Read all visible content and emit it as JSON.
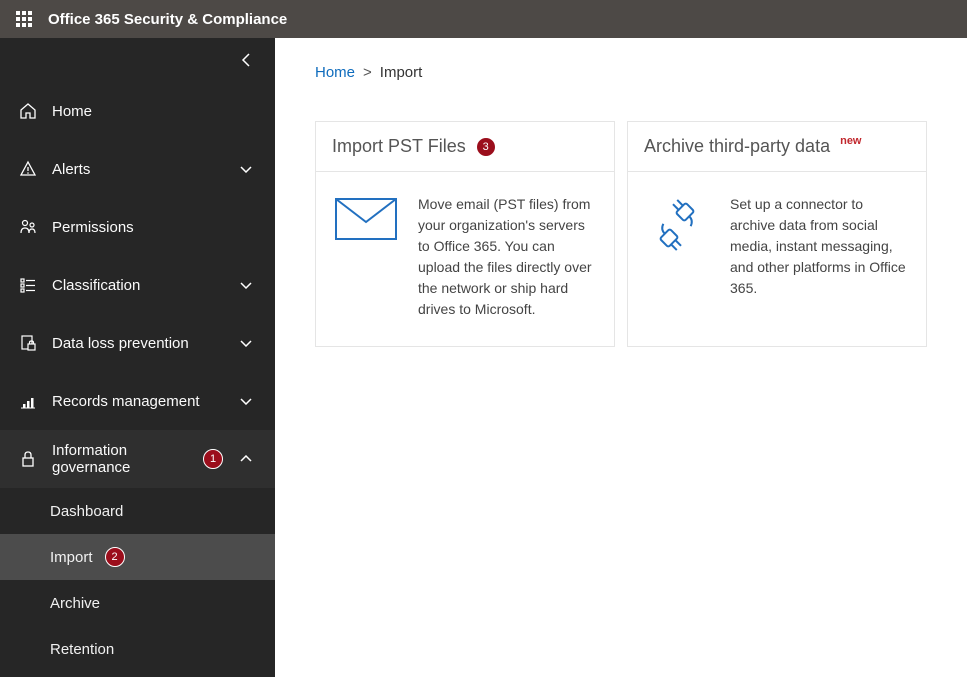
{
  "header": {
    "app_title": "Office 365 Security & Compliance"
  },
  "sidebar": {
    "items": [
      {
        "id": "home",
        "label": "Home",
        "icon": "home-icon",
        "expandable": false
      },
      {
        "id": "alerts",
        "label": "Alerts",
        "icon": "alert-icon",
        "expandable": true
      },
      {
        "id": "permissions",
        "label": "Permissions",
        "icon": "permissions-icon",
        "expandable": false
      },
      {
        "id": "classification",
        "label": "Classification",
        "icon": "classification-icon",
        "expandable": true
      },
      {
        "id": "dlp",
        "label": "Data loss prevention",
        "icon": "dlp-icon",
        "expandable": true
      },
      {
        "id": "records",
        "label": "Records management",
        "icon": "records-icon",
        "expandable": true
      },
      {
        "id": "info-gov",
        "label": "Information governance",
        "icon": "lock-icon",
        "expandable": true,
        "expanded": true,
        "badge": "1",
        "children": [
          {
            "id": "dashboard",
            "label": "Dashboard"
          },
          {
            "id": "import",
            "label": "Import",
            "selected": true,
            "badge": "2"
          },
          {
            "id": "archive",
            "label": "Archive"
          },
          {
            "id": "retention",
            "label": "Retention"
          }
        ]
      }
    ]
  },
  "breadcrumb": {
    "root": "Home",
    "separator": ">",
    "current": "Import"
  },
  "cards": [
    {
      "title": "Import PST Files",
      "badge": "3",
      "icon": "envelope-icon",
      "description": "Move email (PST files) from your organization's servers to Office 365. You can upload the files directly over the network or ship hard drives to Microsoft."
    },
    {
      "title": "Archive third-party data",
      "tag": "new",
      "icon": "connector-icon",
      "description": "Set up a connector to archive data from social media, instant messaging, and other platforms in Office 365."
    }
  ]
}
